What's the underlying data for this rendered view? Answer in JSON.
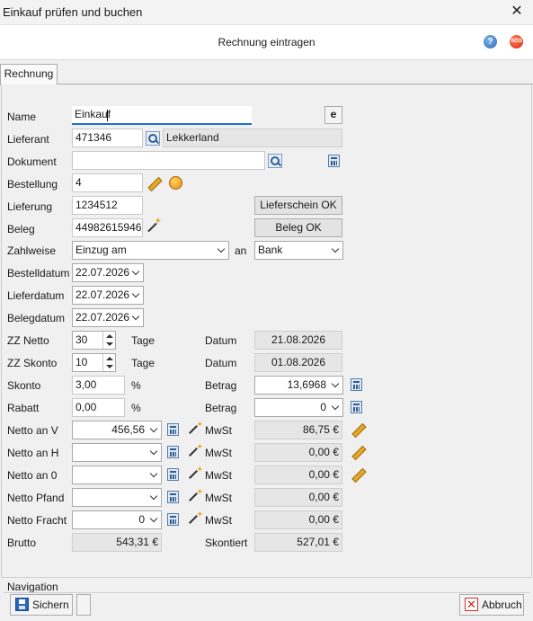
{
  "window": {
    "title": "Einkauf prüfen und buchen",
    "close": "✕"
  },
  "header": {
    "title": "Rechnung eintragen",
    "help": "?",
    "sos": "SOS"
  },
  "tabs": [
    {
      "label": "Rechnung"
    }
  ],
  "form": {
    "name": {
      "label": "Name",
      "value": "Einkauf",
      "e_button": "e"
    },
    "lieferant": {
      "label": "Lieferant",
      "value": "471346",
      "name": "Lekkerland"
    },
    "dokument": {
      "label": "Dokument",
      "value": ""
    },
    "bestellung": {
      "label": "Bestellung",
      "value": "4"
    },
    "lieferung": {
      "label": "Lieferung",
      "value": "1234512",
      "status": "Lieferschein OK"
    },
    "beleg": {
      "label": "Beleg",
      "value": "44982615946",
      "status": "Beleg OK"
    },
    "zahlweise": {
      "label": "Zahlweise",
      "value": "Einzug am",
      "an_label": "an",
      "an_value": "Bank"
    },
    "bestelldatum": {
      "label": "Bestelldatum",
      "value": "22.07.2026"
    },
    "lieferdatum": {
      "label": "Lieferdatum",
      "value": "22.07.2026"
    },
    "belegdatum": {
      "label": "Belegdatum",
      "value": "22.07.2026"
    },
    "zz_netto": {
      "label": "ZZ Netto",
      "value": "30",
      "unit": "Tage",
      "datum_label": "Datum",
      "datum": "21.08.2026"
    },
    "zz_skonto": {
      "label": "ZZ Skonto",
      "value": "10",
      "unit": "Tage",
      "datum_label": "Datum",
      "datum": "01.08.2026"
    },
    "skonto": {
      "label": "Skonto",
      "value": "3,00",
      "unit": "%",
      "betrag_label": "Betrag",
      "betrag": "13,6968"
    },
    "rabatt": {
      "label": "Rabatt",
      "value": "0,00",
      "unit": "%",
      "betrag_label": "Betrag",
      "betrag": "0"
    },
    "netto_rows": [
      {
        "label": "Netto an V",
        "value": "456,56",
        "mwst_label": "MwSt",
        "mwst": "86,75 €",
        "edit": true
      },
      {
        "label": "Netto an H",
        "value": "",
        "mwst_label": "MwSt",
        "mwst": "0,00 €",
        "edit": true
      },
      {
        "label": "Netto an 0",
        "value": "",
        "mwst_label": "MwSt",
        "mwst": "0,00 €",
        "edit": true
      },
      {
        "label": "Netto Pfand",
        "value": "",
        "mwst_label": "MwSt",
        "mwst": "0,00 €",
        "edit": false
      },
      {
        "label": "Netto Fracht",
        "value": "0",
        "mwst_label": "MwSt",
        "mwst": "0,00 €",
        "edit": false
      }
    ],
    "brutto": {
      "label": "Brutto",
      "value": "543,31 €",
      "skontiert_label": "Skontiert",
      "skontiert": "527,01 €"
    }
  },
  "footer": {
    "navigation_label": "Navigation",
    "save": "Sichern",
    "cancel": "Abbruch"
  }
}
